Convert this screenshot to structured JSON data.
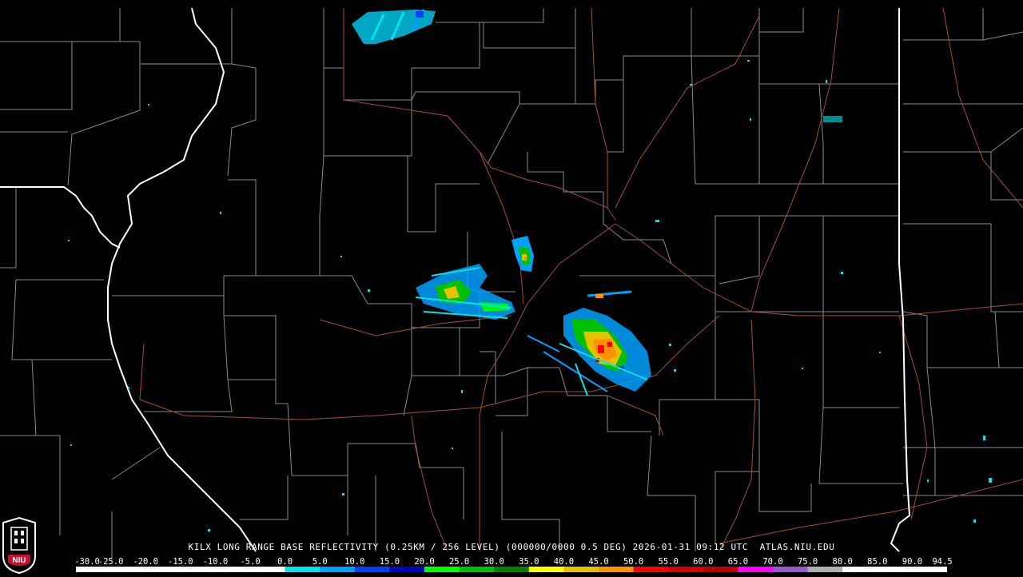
{
  "product_title": "KILX LONG RANGE BASE REFLECTIVITY (0.25KM / 256 LEVEL) (000000/0000 0.5 DEG) 2026-01-31 09:12 UTC  ATLAS.NIU.EDU",
  "logo_text": "NIU",
  "scale": {
    "ticks": [
      "-30.0",
      "-25.0",
      "-20.0",
      "-15.0",
      "-10.0",
      "-5.0",
      "0.0",
      "5.0",
      "10.0",
      "15.0",
      "20.0",
      "25.0",
      "30.0",
      "35.0",
      "40.0",
      "45.0",
      "50.0",
      "55.0",
      "60.0",
      "65.0",
      "70.0",
      "75.0",
      "80.0",
      "85.0",
      "90.0",
      "94.5"
    ],
    "colors": [
      "#ffffff",
      "#ffffff",
      "#ffffff",
      "#ffffff",
      "#ffffff",
      "#ffffff",
      "#00e5e5",
      "#00a0ff",
      "#0040ff",
      "#0000c0",
      "#00ff00",
      "#00c000",
      "#008000",
      "#ffff00",
      "#e7c000",
      "#ff9000",
      "#ff0000",
      "#d60000",
      "#c00000",
      "#ff00ff",
      "#9955c9",
      "#b0b0b0",
      "#ffffff",
      "#ffffff",
      "#ffffff"
    ]
  },
  "map_colors": {
    "county_lines": "#8a8a8a",
    "state_lines": "#ffffff",
    "highways": "#a0522d",
    "background": "#000000"
  }
}
